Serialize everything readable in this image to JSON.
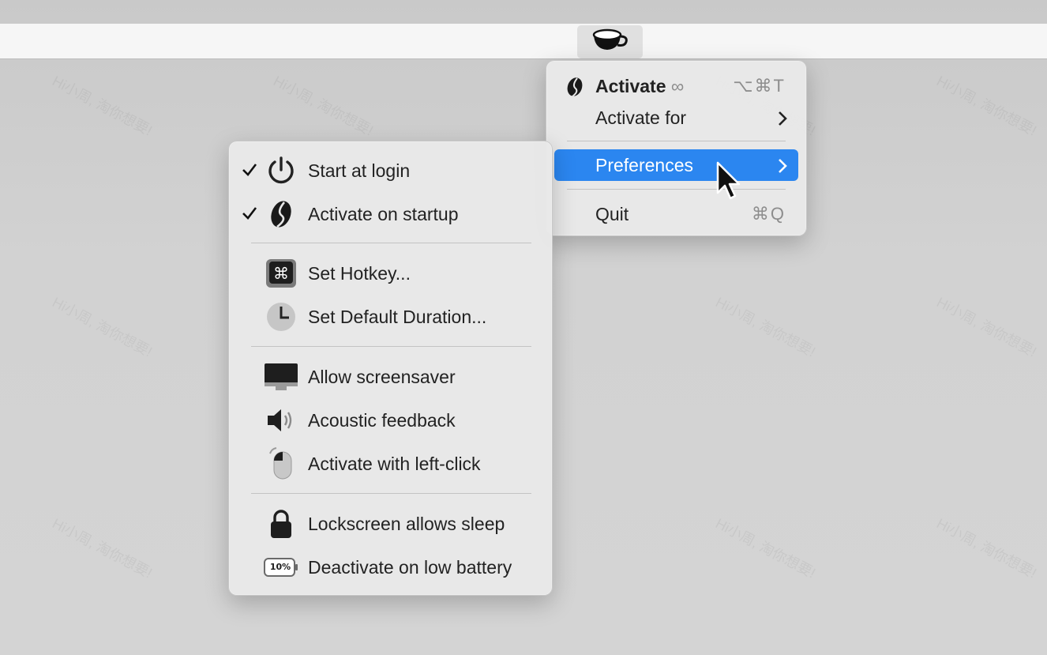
{
  "menubar": {
    "app_icon": "coffee-cup-icon"
  },
  "main_menu": {
    "items": [
      {
        "label": "Activate",
        "suffix": "∞",
        "shortcut": "⌥⌘T",
        "icon": "coffee-bean-icon"
      },
      {
        "label": "Activate for",
        "submenu": true
      },
      {
        "label": "Preferences",
        "submenu": true,
        "selected": true
      },
      {
        "label": "Quit",
        "shortcut": "⌘Q"
      }
    ]
  },
  "preferences_menu": {
    "items": [
      {
        "label": "Start at login",
        "checked": true,
        "icon": "power-icon"
      },
      {
        "label": "Activate on startup",
        "checked": true,
        "icon": "coffee-bean-icon"
      },
      {
        "label": "Set Hotkey...",
        "icon": "command-key-icon"
      },
      {
        "label": "Set Default Duration...",
        "icon": "clock-icon"
      },
      {
        "label": "Allow screensaver",
        "icon": "display-icon"
      },
      {
        "label": "Acoustic feedback",
        "icon": "speaker-icon"
      },
      {
        "label": "Activate with left-click",
        "icon": "mouse-icon"
      },
      {
        "label": "Lockscreen allows sleep",
        "icon": "lock-icon"
      },
      {
        "label": "Deactivate on low battery",
        "icon": "battery-icon",
        "icon_text": "10%"
      }
    ]
  },
  "colors": {
    "selection": "#2b86f0",
    "menu_background": "#e8e8e8",
    "shortcut_text": "#8d8d8d"
  }
}
